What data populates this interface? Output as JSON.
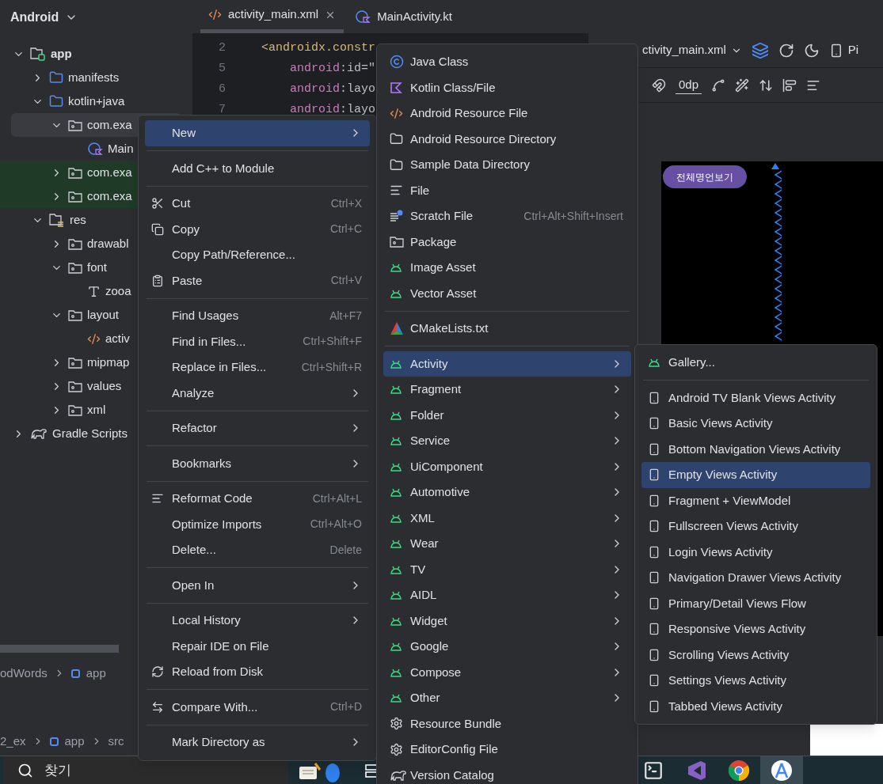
{
  "project_panel": {
    "title": "Android",
    "tree": [
      {
        "label": "app",
        "kind": "module",
        "expanded": true,
        "selected": false,
        "highlighted": false,
        "children": [
          {
            "label": "manifests",
            "kind": "source_folder",
            "expanded": false,
            "selected": false,
            "highlighted": false
          },
          {
            "label": "kotlin+java",
            "kind": "source_folder",
            "expanded": true,
            "selected": false,
            "highlighted": false,
            "children": [
              {
                "label": "com.exa",
                "kind": "package",
                "expanded": true,
                "selected": true,
                "highlighted": false,
                "children": [
                  {
                    "label": "Main",
                    "kind": "kotlin",
                    "selected": false,
                    "highlighted": false
                  }
                ]
              },
              {
                "label": "com.exa",
                "kind": "package",
                "expanded": false,
                "selected": false,
                "highlighted": true
              },
              {
                "label": "com.exa",
                "kind": "package",
                "expanded": false,
                "selected": false,
                "highlighted": true
              }
            ]
          },
          {
            "label": "res",
            "kind": "resources",
            "expanded": true,
            "selected": false,
            "highlighted": false,
            "children": [
              {
                "label": "drawabl",
                "kind": "package",
                "expanded": false,
                "selected": false,
                "highlighted": false
              },
              {
                "label": "font",
                "kind": "package",
                "expanded": true,
                "selected": false,
                "highlighted": false,
                "children": [
                  {
                    "label": "zooa",
                    "kind": "font",
                    "selected": false,
                    "highlighted": false
                  }
                ]
              },
              {
                "label": "layout",
                "kind": "package",
                "expanded": true,
                "selected": false,
                "highlighted": false,
                "children": [
                  {
                    "label": "activ",
                    "kind": "xml",
                    "selected": false,
                    "highlighted": false
                  }
                ]
              },
              {
                "label": "mipmap",
                "kind": "package",
                "expanded": false,
                "selected": false,
                "highlighted": false
              },
              {
                "label": "values",
                "kind": "package",
                "expanded": false,
                "selected": false,
                "highlighted": false
              },
              {
                "label": "xml",
                "kind": "package",
                "expanded": false,
                "selected": false,
                "highlighted": false
              }
            ]
          }
        ]
      },
      {
        "label": "Gradle Scripts",
        "kind": "gradle",
        "expanded": false,
        "selected": false,
        "highlighted": false
      }
    ]
  },
  "breadcrumbs": [
    {
      "items": [
        {
          "label": "odWords",
          "kind": "text"
        },
        {
          "label": "app",
          "kind": "module"
        }
      ]
    },
    {
      "items": [
        {
          "label": "2_ex",
          "kind": "text"
        },
        {
          "label": "app",
          "kind": "module"
        },
        {
          "label": "src",
          "kind": "text"
        }
      ]
    }
  ],
  "editor_tabs": [
    {
      "label": "activity_main.xml",
      "kind": "xml",
      "selected": true,
      "closable": true
    },
    {
      "label": "MainActivity.kt",
      "kind": "kotlin",
      "selected": false,
      "closable": false
    }
  ],
  "code_lines": [
    {
      "number": "2",
      "kind": "tag",
      "text": "<androidx.constr"
    },
    {
      "number": "5",
      "kind": "attribute",
      "namespace": "android",
      "text": ":id=\""
    },
    {
      "number": "6",
      "kind": "attribute",
      "namespace": "android",
      "text": ":layo"
    },
    {
      "number": "7",
      "kind": "attribute",
      "namespace": "android",
      "text": ":layo"
    }
  ],
  "design_toolbar": {
    "file_selector": "ctivity_main.xml",
    "device_label": "Pi",
    "margin_value": "0dp"
  },
  "preview": {
    "button_label": "전체명언보기"
  },
  "context_menu": {
    "items": [
      {
        "kind": "plain",
        "label": "New",
        "selected": true,
        "submenu": true
      },
      {
        "kind": "separator"
      },
      {
        "kind": "plain",
        "label": "Add C++ to Module",
        "selected": false,
        "submenu": false
      },
      {
        "kind": "separator"
      },
      {
        "kind": "cut",
        "label": "Cut",
        "shortcut": "Ctrl+X",
        "selected": false,
        "submenu": false
      },
      {
        "kind": "copy",
        "label": "Copy",
        "shortcut": "Ctrl+C",
        "selected": false,
        "submenu": false
      },
      {
        "kind": "plain",
        "label": "Copy Path/Reference...",
        "selected": false,
        "submenu": false
      },
      {
        "kind": "paste",
        "label": "Paste",
        "shortcut": "Ctrl+V",
        "selected": false,
        "submenu": false
      },
      {
        "kind": "separator"
      },
      {
        "kind": "plain",
        "label": "Find Usages",
        "shortcut": "Alt+F7",
        "selected": false,
        "submenu": false
      },
      {
        "kind": "plain",
        "label": "Find in Files...",
        "shortcut": "Ctrl+Shift+F",
        "selected": false,
        "submenu": false
      },
      {
        "kind": "plain",
        "label": "Replace in Files...",
        "shortcut": "Ctrl+Shift+R",
        "selected": false,
        "submenu": false
      },
      {
        "kind": "plain",
        "label": "Analyze",
        "selected": false,
        "submenu": true
      },
      {
        "kind": "separator"
      },
      {
        "kind": "plain",
        "label": "Refactor",
        "selected": false,
        "submenu": true
      },
      {
        "kind": "separator"
      },
      {
        "kind": "plain",
        "label": "Bookmarks",
        "selected": false,
        "submenu": true
      },
      {
        "kind": "separator"
      },
      {
        "kind": "reformat",
        "label": "Reformat Code",
        "shortcut": "Ctrl+Alt+L",
        "selected": false,
        "submenu": false
      },
      {
        "kind": "plain",
        "label": "Optimize Imports",
        "shortcut": "Ctrl+Alt+O",
        "selected": false,
        "submenu": false
      },
      {
        "kind": "plain",
        "label": "Delete...",
        "shortcut": "Delete",
        "selected": false,
        "submenu": false
      },
      {
        "kind": "separator"
      },
      {
        "kind": "plain",
        "label": "Open In",
        "selected": false,
        "submenu": true
      },
      {
        "kind": "separator"
      },
      {
        "kind": "plain",
        "label": "Local History",
        "selected": false,
        "submenu": true
      },
      {
        "kind": "plain",
        "label": "Repair IDE on File",
        "selected": false,
        "submenu": false
      },
      {
        "kind": "reload",
        "label": "Reload from Disk",
        "selected": false,
        "submenu": false
      },
      {
        "kind": "separator"
      },
      {
        "kind": "compare",
        "label": "Compare With...",
        "shortcut": "Ctrl+D",
        "selected": false,
        "submenu": false
      },
      {
        "kind": "separator"
      },
      {
        "kind": "plain",
        "label": "Mark Directory as",
        "selected": false,
        "submenu": true
      }
    ]
  },
  "new_submenu": {
    "items": [
      {
        "kind": "java_class",
        "label": "Java Class",
        "selected": false,
        "submenu": false
      },
      {
        "kind": "kotlin_file",
        "label": "Kotlin Class/File",
        "selected": false,
        "submenu": false
      },
      {
        "kind": "resource_file",
        "label": "Android Resource File",
        "selected": false,
        "submenu": false
      },
      {
        "kind": "directory",
        "label": "Android Resource Directory",
        "selected": false,
        "submenu": false
      },
      {
        "kind": "directory",
        "label": "Sample Data Directory",
        "selected": false,
        "submenu": false
      },
      {
        "kind": "file",
        "label": "File",
        "selected": false,
        "submenu": false
      },
      {
        "kind": "scratch",
        "label": "Scratch File",
        "shortcut": "Ctrl+Alt+Shift+Insert",
        "selected": false,
        "submenu": false
      },
      {
        "kind": "package",
        "label": "Package",
        "selected": false,
        "submenu": false
      },
      {
        "kind": "android",
        "label": "Image Asset",
        "selected": false,
        "submenu": false
      },
      {
        "kind": "android",
        "label": "Vector Asset",
        "selected": false,
        "submenu": false
      },
      {
        "kind": "separator"
      },
      {
        "kind": "cmake",
        "label": "CMakeLists.txt",
        "selected": false,
        "submenu": false
      },
      {
        "kind": "separator"
      },
      {
        "kind": "android",
        "label": "Activity",
        "selected": true,
        "submenu": true
      },
      {
        "kind": "android",
        "label": "Fragment",
        "selected": false,
        "submenu": true
      },
      {
        "kind": "android",
        "label": "Folder",
        "selected": false,
        "submenu": true
      },
      {
        "kind": "android",
        "label": "Service",
        "selected": false,
        "submenu": true
      },
      {
        "kind": "android",
        "label": "UiComponent",
        "selected": false,
        "submenu": true
      },
      {
        "kind": "android",
        "label": "Automotive",
        "selected": false,
        "submenu": true
      },
      {
        "kind": "android",
        "label": "XML",
        "selected": false,
        "submenu": true
      },
      {
        "kind": "android",
        "label": "Wear",
        "selected": false,
        "submenu": true
      },
      {
        "kind": "android",
        "label": "TV",
        "selected": false,
        "submenu": true
      },
      {
        "kind": "android",
        "label": "AIDL",
        "selected": false,
        "submenu": true
      },
      {
        "kind": "android",
        "label": "Widget",
        "selected": false,
        "submenu": true
      },
      {
        "kind": "android",
        "label": "Google",
        "selected": false,
        "submenu": true
      },
      {
        "kind": "android",
        "label": "Compose",
        "selected": false,
        "submenu": true
      },
      {
        "kind": "android",
        "label": "Other",
        "selected": false,
        "submenu": true
      },
      {
        "kind": "settings_file",
        "label": "Resource Bundle",
        "selected": false,
        "submenu": false
      },
      {
        "kind": "settings_file",
        "label": "EditorConfig File",
        "selected": false,
        "submenu": false
      },
      {
        "kind": "gradle",
        "label": "Version Catalog",
        "selected": false,
        "submenu": false
      }
    ]
  },
  "activity_submenu": {
    "items": [
      {
        "kind": "android",
        "label": "Gallery...",
        "selected": false,
        "submenu": false
      },
      {
        "kind": "separator"
      },
      {
        "kind": "template",
        "label": "Android TV Blank Views Activity",
        "selected": false,
        "submenu": false
      },
      {
        "kind": "template",
        "label": "Basic Views Activity",
        "selected": false,
        "submenu": false
      },
      {
        "kind": "template",
        "label": "Bottom Navigation Views Activity",
        "selected": false,
        "submenu": false
      },
      {
        "kind": "template",
        "label": "Empty Views Activity",
        "selected": true,
        "submenu": false
      },
      {
        "kind": "template",
        "label": "Fragment + ViewModel",
        "selected": false,
        "submenu": false
      },
      {
        "kind": "template",
        "label": "Fullscreen Views Activity",
        "selected": false,
        "submenu": false
      },
      {
        "kind": "template",
        "label": "Login Views Activity",
        "selected": false,
        "submenu": false
      },
      {
        "kind": "template",
        "label": "Navigation Drawer Views Activity",
        "selected": false,
        "submenu": false
      },
      {
        "kind": "template",
        "label": "Primary/Detail Views Flow",
        "selected": false,
        "submenu": false
      },
      {
        "kind": "template",
        "label": "Responsive Views Activity",
        "selected": false,
        "submenu": false
      },
      {
        "kind": "template",
        "label": "Scrolling Views Activity",
        "selected": false,
        "submenu": false
      },
      {
        "kind": "template",
        "label": "Settings Views Activity",
        "selected": false,
        "submenu": false
      },
      {
        "kind": "template",
        "label": "Tabbed Views Activity",
        "selected": false,
        "submenu": false
      }
    ]
  },
  "taskbar": {
    "search_placeholder": "찾기",
    "apps": [
      {
        "kind": "widgets",
        "selected": false
      },
      {
        "kind": "task_view",
        "selected": false
      },
      {
        "kind": "terminal",
        "selected": false
      },
      {
        "kind": "visual_studio",
        "selected": false
      },
      {
        "kind": "chrome",
        "selected": false
      },
      {
        "kind": "android_studio",
        "selected": true
      }
    ]
  }
}
